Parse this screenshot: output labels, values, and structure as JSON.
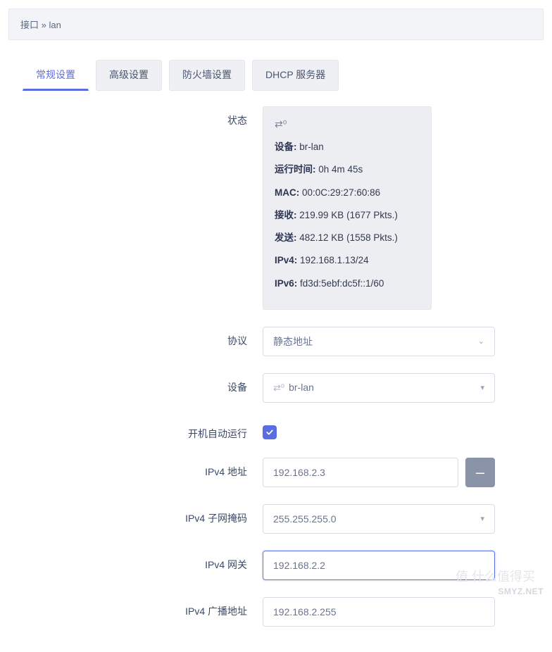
{
  "breadcrumb": {
    "part1": "接口",
    "sep": " » ",
    "part2": "lan"
  },
  "tabs": [
    {
      "label": "常规设置",
      "active": true
    },
    {
      "label": "高级设置",
      "active": false
    },
    {
      "label": "防火墙设置",
      "active": false
    },
    {
      "label": "DHCP 服务器",
      "active": false
    }
  ],
  "labels": {
    "status": "状态",
    "protocol": "协议",
    "device": "设备",
    "autostart": "开机自动运行",
    "ipv4_addr": "IPv4 地址",
    "ipv4_mask": "IPv4 子网掩码",
    "ipv4_gateway": "IPv4 网关",
    "ipv4_broadcast": "IPv4 广播地址"
  },
  "status": {
    "device_label": "设备:",
    "device_value": "br-lan",
    "uptime_label": "运行时间:",
    "uptime_value": "0h 4m 45s",
    "mac_label": "MAC:",
    "mac_value": "00:0C:29:27:60:86",
    "rx_label": "接收:",
    "rx_value": "219.99 KB (1677 Pkts.)",
    "tx_label": "发送:",
    "tx_value": "482.12 KB (1558 Pkts.)",
    "ipv4_label": "IPv4:",
    "ipv4_value": "192.168.1.13/24",
    "ipv6_label": "IPv6:",
    "ipv6_value": "fd3d:5ebf:dc5f::1/60"
  },
  "form": {
    "protocol_value": "静态地址",
    "device_value": "br-lan",
    "autostart_checked": true,
    "ipv4_addr_value": "192.168.2.3",
    "ipv4_mask_value": "255.255.255.0",
    "ipv4_gateway_value": "192.168.2.2",
    "ipv4_broadcast_value": "192.168.2.255",
    "remove_button": "–"
  },
  "watermark": "SMYZ.NET",
  "watermark2": "值 什么值得买"
}
